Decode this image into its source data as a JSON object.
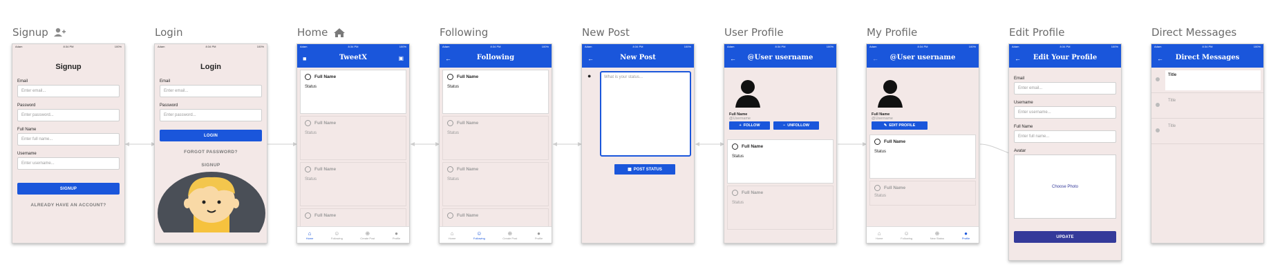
{
  "frames": {
    "signup": {
      "label": "Signup"
    },
    "login": {
      "label": "Login"
    },
    "home": {
      "label": "Home"
    },
    "following": {
      "label": "Following"
    },
    "newpost": {
      "label": "New Post"
    },
    "userprofile": {
      "label": "User Profile"
    },
    "myprofile": {
      "label": "My Profile"
    },
    "editprofile": {
      "label": "Edit Profile"
    },
    "dm": {
      "label": "Direct Messages"
    }
  },
  "status_bar": {
    "carrier": "Adam",
    "time": "8:34 PM",
    "battery": "100%"
  },
  "signup": {
    "title": "Signup",
    "email_label": "Email",
    "email_ph": "Enter email...",
    "password_label": "Password",
    "password_ph": "Enter password...",
    "fullname_label": "Full Name",
    "fullname_ph": "Enter full name...",
    "username_label": "Username",
    "username_ph": "Enter username...",
    "button": "SIGNUP",
    "link": "ALREADY HAVE AN ACCOUNT?"
  },
  "login": {
    "title": "Login",
    "email_label": "Email",
    "email_ph": "Enter email...",
    "password_label": "Password",
    "password_ph": "Enter password...",
    "button": "LOGIN",
    "forgot": "FORGOT PASSWORD?",
    "signup": "SIGNUP"
  },
  "home": {
    "title": "TweetX",
    "posts": [
      {
        "name": "Full Name",
        "status": "Status"
      },
      {
        "name": "Full Name",
        "status": "Status"
      },
      {
        "name": "Full Name",
        "status": "Status"
      },
      {
        "name": "Full Name",
        "status": ""
      }
    ],
    "nav": [
      "Home",
      "Following",
      "Create Post",
      "Profile"
    ]
  },
  "following": {
    "title": "Following",
    "posts": [
      {
        "name": "Full Name",
        "status": "Status"
      },
      {
        "name": "Full Name",
        "status": "Status"
      },
      {
        "name": "Full Name",
        "status": "Status"
      },
      {
        "name": "Full Name",
        "status": ""
      }
    ],
    "nav": [
      "Home",
      "Following",
      "Create Post",
      "Profile"
    ]
  },
  "newpost": {
    "title": "New Post",
    "placeholder": "What is your status...",
    "button": "POST STATUS"
  },
  "userprofile": {
    "title": "@User username",
    "full_name": "Full Name",
    "username": "@Username",
    "follow": "FOLLOW",
    "unfollow": "UNFOLLOW",
    "posts": [
      {
        "name": "Full Name",
        "status": "Status"
      },
      {
        "name": "Full Name",
        "status": "Status"
      }
    ]
  },
  "myprofile": {
    "title": "@User username",
    "full_name": "Full Name",
    "username": "@Username",
    "edit": "EDIT PROFILE",
    "posts": [
      {
        "name": "Full Name",
        "status": "Status"
      },
      {
        "name": "Full Name",
        "status": "Status"
      }
    ],
    "nav": [
      "Home",
      "Following",
      "New Status",
      "Profile"
    ]
  },
  "editprofile": {
    "title": "Edit Your Profile",
    "email_label": "Email",
    "email_ph": "Enter email...",
    "username_label": "Username",
    "username_ph": "Enter username...",
    "fullname_label": "Full Name",
    "fullname_ph": "Enter full name...",
    "avatar_label": "Avatar",
    "choose_photo": "Choose Photo",
    "button": "UPDATE"
  },
  "dm": {
    "title": "Direct Messages",
    "threads": [
      "Title",
      "Title",
      "Title"
    ]
  },
  "colors": {
    "accent": "#1a56db",
    "screen_bg": "#f3e8e7",
    "update_btn": "#343a9a"
  }
}
